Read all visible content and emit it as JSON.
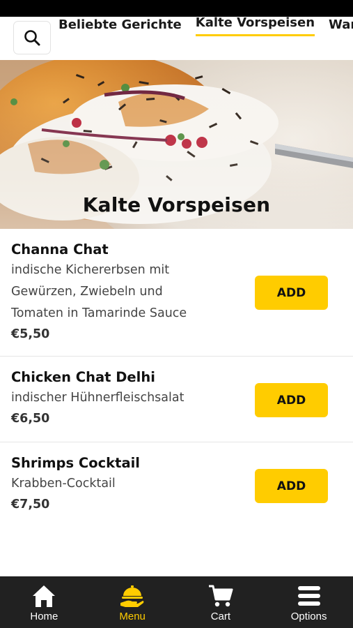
{
  "categories": [
    "Beliebte Gerichte",
    "Kalte Vorspeisen",
    "Warme Vorspeisen"
  ],
  "active_category": "Kalte Vorspeisen",
  "hero": {
    "title": "Kalte Vorspeisen"
  },
  "items": [
    {
      "name": "Channa Chat",
      "desc_lines": [
        "indische Kichererbsen mit",
        "Gewürzen, Zwiebeln und",
        "Tomaten in Tamarinde Sauce"
      ],
      "price": "€5,50",
      "button": "ADD"
    },
    {
      "name": "Chicken Chat Delhi",
      "desc_lines": [
        "indischer Hühnerfleischsalat"
      ],
      "price": "€6,50",
      "button": "ADD"
    },
    {
      "name": "Shrimps Cocktail",
      "desc_lines": [
        "Krabben-Cocktail"
      ],
      "price": "€7,50",
      "button": "ADD"
    }
  ],
  "nav": [
    {
      "label": "Home",
      "icon": "home-icon"
    },
    {
      "label": "Menu",
      "icon": "serving-hand-icon",
      "active": true
    },
    {
      "label": "Cart",
      "icon": "cart-icon"
    },
    {
      "label": "Options",
      "icon": "hamburger-menu-icon"
    }
  ],
  "colors": {
    "accent": "#ffcc00",
    "nav_bg": "#212121",
    "status_bar": "#000000"
  }
}
